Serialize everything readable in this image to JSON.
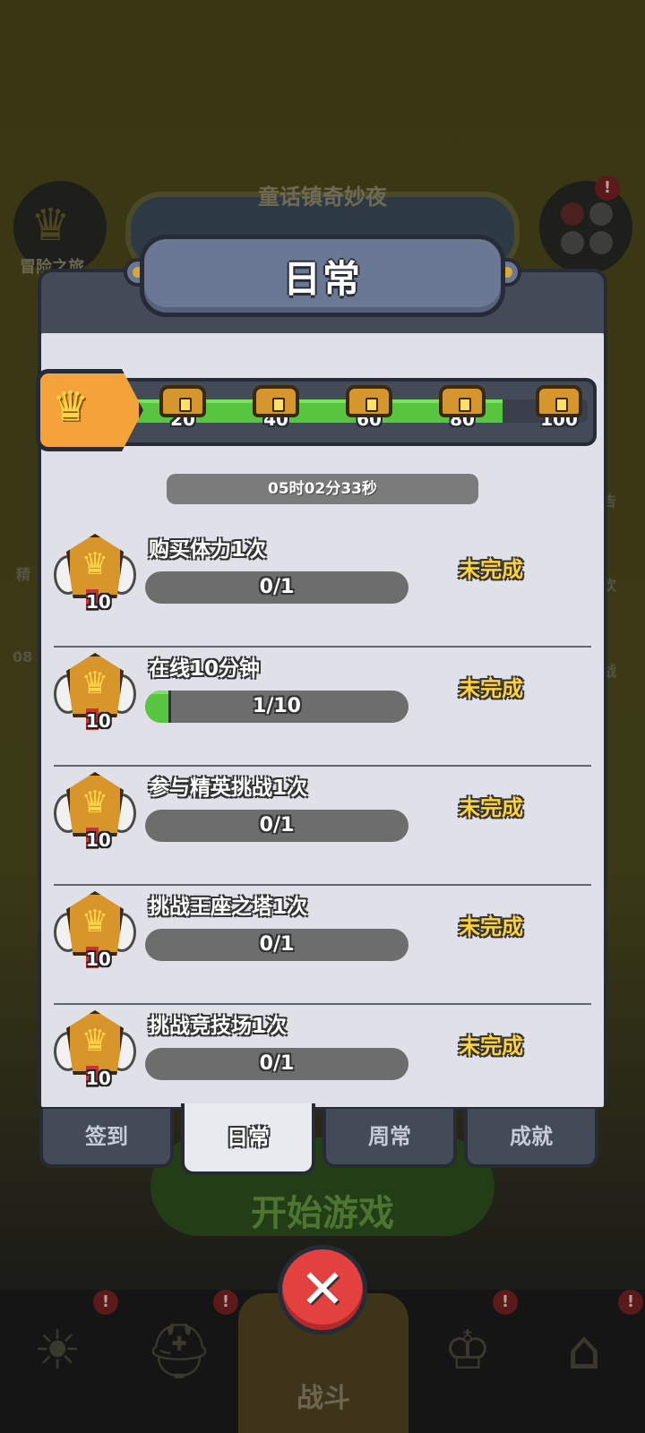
{
  "background": {
    "event_title": "童话镇奇妙夜",
    "left_label": "冒险之旅",
    "start_button": "开始游戏",
    "nav_battle": "战斗",
    "side_labels": [
      "精",
      "08",
      "告",
      "欢",
      "战"
    ]
  },
  "dialog": {
    "title": "日常",
    "milestones": [
      "20",
      "40",
      "60",
      "80",
      "100"
    ],
    "progress_fraction": 0.82,
    "timer": "05时02分33秒",
    "tasks": [
      {
        "title": "购买体力1次",
        "progress_text": "0/1",
        "progress_fraction": 0,
        "reward": "10",
        "status": "未完成"
      },
      {
        "title": "在线10分钟",
        "progress_text": "1/10",
        "progress_fraction": 0.1,
        "reward": "10",
        "status": "未完成"
      },
      {
        "title": "参与精英挑战1次",
        "progress_text": "0/1",
        "progress_fraction": 0,
        "reward": "10",
        "status": "未完成"
      },
      {
        "title": "挑战王座之塔1次",
        "progress_text": "0/1",
        "progress_fraction": 0,
        "reward": "10",
        "status": "未完成"
      },
      {
        "title": "挑战竞技场1次",
        "progress_text": "0/1",
        "progress_fraction": 0,
        "reward": "10",
        "status": "未完成"
      }
    ],
    "tabs": [
      "签到",
      "日常",
      "周常",
      "成就"
    ],
    "active_tab": 1,
    "close_icon": "close-x-icon"
  },
  "colors": {
    "progress_green": "#57c540",
    "status_yellow": "#ffd23a",
    "close_red": "#e3413f",
    "panel_slate": "#434a58"
  }
}
